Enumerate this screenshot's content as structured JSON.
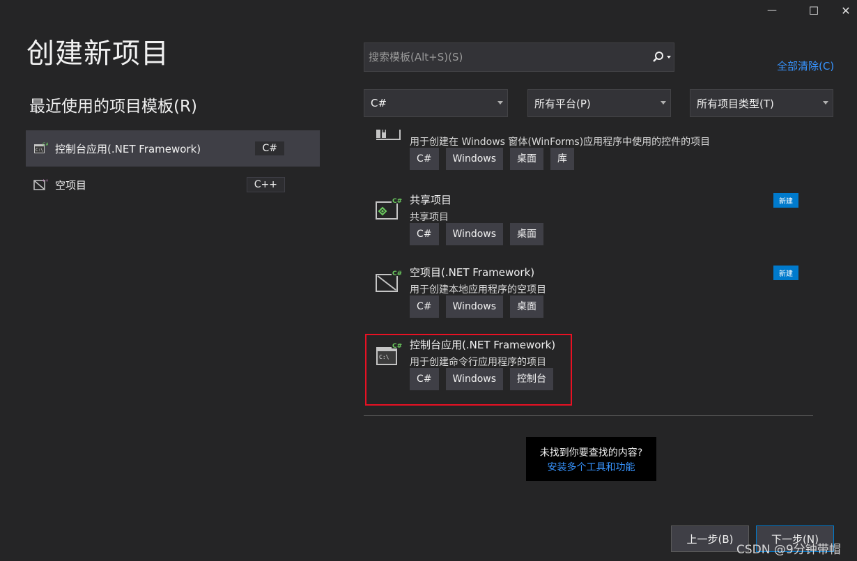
{
  "window": {
    "minimize_glyph": "—",
    "maximize_glyph": "☐",
    "close_glyph": "✕"
  },
  "page_title": "创建新项目",
  "recent": {
    "title": "最近使用的项目模板(R)",
    "items": [
      {
        "label": "控制台应用(.NET Framework)",
        "lang": "C#",
        "icon": "console-app-icon"
      },
      {
        "label": "空项目",
        "lang": "C++",
        "icon": "empty-project-icon"
      }
    ]
  },
  "search": {
    "placeholder": "搜索模板(Alt+S)(S)",
    "icon": "search-icon"
  },
  "clear_all": "全部清除(C)",
  "filters": {
    "language": "C#",
    "platform": "所有平台(P)",
    "project_type": "所有项目类型(T)"
  },
  "templates": [
    {
      "name": "",
      "desc": "用于创建在 Windows 窗体(WinForms)应用程序中使用的控件的项目",
      "tags": [
        "C#",
        "Windows",
        "桌面",
        "库"
      ],
      "badge": "",
      "icon": "winforms-control-library-icon"
    },
    {
      "name": "共享项目",
      "desc": "共享项目",
      "tags": [
        "C#",
        "Windows",
        "桌面"
      ],
      "badge": "新建",
      "icon": "shared-project-icon"
    },
    {
      "name": "空项目(.NET Framework)",
      "desc": "用于创建本地应用程序的空项目",
      "tags": [
        "C#",
        "Windows",
        "桌面"
      ],
      "badge": "新建",
      "icon": "empty-project-icon"
    },
    {
      "name": "控制台应用(.NET Framework)",
      "desc": "用于创建命令行应用程序的项目",
      "tags": [
        "C#",
        "Windows",
        "控制台"
      ],
      "badge": "",
      "icon": "console-app-icon"
    }
  ],
  "not_found": {
    "question": "未找到你要查找的内容?",
    "link": "安装多个工具和功能"
  },
  "buttons": {
    "back": "上一步(B)",
    "next": "下一步(N)"
  },
  "watermark": "CSDN @9分钟带帽",
  "colors": {
    "background": "#252526",
    "accent": "#007acc",
    "link": "#3794ff",
    "highlight": "#e81123"
  }
}
